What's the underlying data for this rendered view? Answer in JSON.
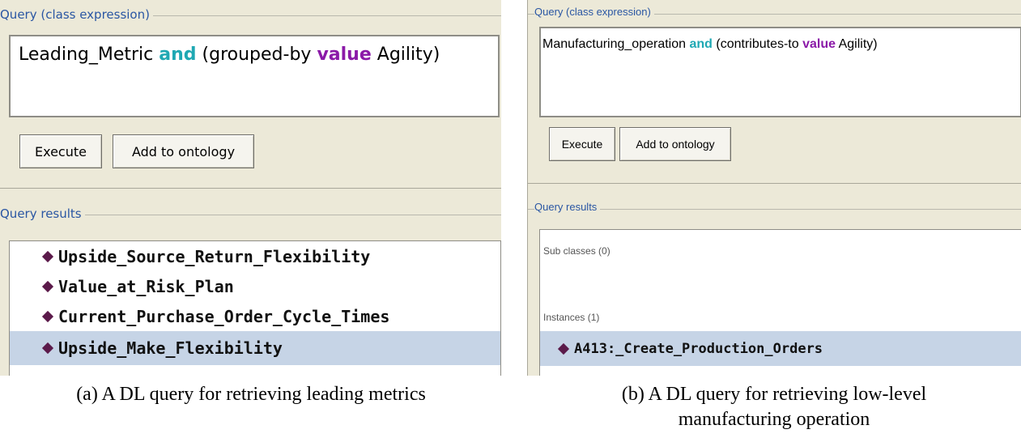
{
  "panel_a": {
    "query_title": "Query (class expression)",
    "expression": {
      "class": "Leading_Metric",
      "and": "and",
      "property": "(grouped-by",
      "value_kw": "value",
      "individual": "Agility)"
    },
    "execute_label": "Execute",
    "add_label": "Add to ontology",
    "results_title": "Query results",
    "results": [
      "Upside_Source_Return_Flexibility",
      "Value_at_Risk_Plan",
      "Current_Purchase_Order_Cycle_Times",
      "Upside_Make_Flexibility"
    ],
    "selected_index": 3,
    "caption": "(a) A DL query for retrieving leading metrics"
  },
  "panel_b": {
    "query_title": "Query (class expression)",
    "expression": {
      "class": "Manufacturing_operation",
      "and": "and",
      "property": "(contributes-to",
      "value_kw": "value",
      "individual": "Agility)"
    },
    "execute_label": "Execute",
    "add_label": "Add to ontology",
    "results_title": "Query results",
    "subclasses_label": "Sub classes (0)",
    "instances_label": "Instances (1)",
    "instance": "A413:_Create_Production_Orders",
    "caption_line1": "(b) A DL query for retrieving low-level",
    "caption_line2": "manufacturing operation"
  },
  "colors": {
    "keyword_and": "#1fa8b3",
    "keyword_value": "#8b1aa8",
    "section_title": "#2a56a3",
    "selection": "#c6d4e6",
    "entity_diamond": "#5b1a4a"
  },
  "icons": {
    "entity": "individual-diamond-icon"
  }
}
